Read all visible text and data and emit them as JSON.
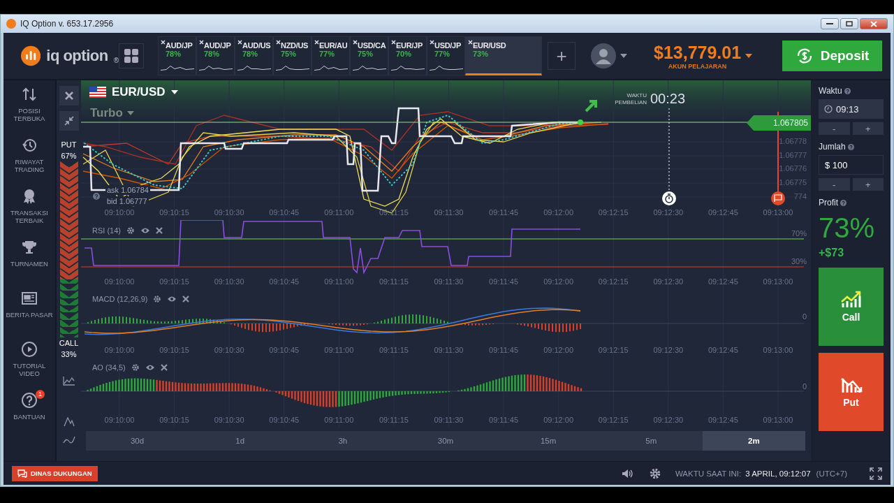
{
  "window": {
    "title": "IQ Option v. 653.17.2956"
  },
  "header": {
    "logo": "iq option",
    "logo_mark": "®",
    "asset_tabs": [
      {
        "pair": "AUD/JP",
        "payout": "78%",
        "selected": false
      },
      {
        "pair": "AUD/JP",
        "payout": "78%",
        "selected": false
      },
      {
        "pair": "AUD/US",
        "payout": "78%",
        "selected": false
      },
      {
        "pair": "NZD/US",
        "payout": "75%",
        "selected": false
      },
      {
        "pair": "EUR/AU",
        "payout": "77%",
        "selected": false
      },
      {
        "pair": "USD/CA",
        "payout": "75%",
        "selected": false
      },
      {
        "pair": "EUR/JP",
        "payout": "70%",
        "selected": false
      },
      {
        "pair": "USD/JP",
        "payout": "77%",
        "selected": false
      },
      {
        "pair": "EUR/USD",
        "payout": "73%",
        "selected": true
      }
    ],
    "balance": "$13,779.01",
    "account": "AKUN PELAJARAN",
    "deposit": "Deposit"
  },
  "sidebar": {
    "items": [
      {
        "label": "POSISI TERBUKA"
      },
      {
        "label": "RIWAYAT TRADING"
      },
      {
        "label": "TRANSAKSI TERBAIK"
      },
      {
        "label": "TURNAMEN"
      },
      {
        "label": "BERITA PASAR"
      },
      {
        "label": "TUTORIAL VIDEO"
      },
      {
        "label": "BANTUAN",
        "badge": "1"
      }
    ]
  },
  "chart": {
    "asset": "EUR/USD",
    "mode": "Turbo",
    "sentiment": {
      "put_label": "PUT",
      "put_share": "67%",
      "call_label": "CALL",
      "call_share": "33%",
      "level": 0.67
    },
    "purchase_label": "WAKTU PEMBELIAN",
    "countdown": "00:23",
    "current_price": "1.067805",
    "price_ticks": [
      "1.06778",
      "1.06777",
      "1.06776",
      "1.06775",
      "774"
    ],
    "ask": "ask 1.06784",
    "bid": "bid 1.06777",
    "time_ticks": [
      "09:10:00",
      "09:10:15",
      "09:10:30",
      "09:10:45",
      "09:11:00",
      "09:11:15",
      "09:11:30",
      "09:11:45",
      "09:12:00",
      "09:12:15",
      "09:12:30",
      "09:12:45",
      "09:13:00"
    ],
    "indicators": [
      {
        "name": "RSI (14)",
        "kind": "rsi",
        "levels": [
          "70%",
          "30%"
        ],
        "time_ticks": [
          "09:10:00",
          "09:10:15",
          "09:10:30",
          "09:10:45",
          "09:11:00",
          "09:11:15",
          "09:11:30",
          "09:11:45",
          "09:12:00",
          "09:12:15",
          "09:12:30",
          "09:12:45",
          "09:13:00"
        ]
      },
      {
        "name": "MACD (12,26,9)",
        "kind": "macd",
        "levels": [
          "0"
        ],
        "time_ticks": [
          "09:10:00",
          "09:10:15",
          "09:10:30",
          "09:10:45",
          "09:11:00",
          "09:11:15",
          "09:11:30",
          "09:11:45",
          "09:12:00",
          "09:12:15",
          "09:12:30",
          "09:12:45",
          "09:13:00"
        ]
      },
      {
        "name": "AO (34,5)",
        "kind": "ao",
        "levels": [
          "0"
        ],
        "time_ticks": [
          "09:10:00",
          "09:10:15",
          "09:10:30",
          "09:10:45",
          "09:11:00",
          "09:11:15",
          "09:11:30",
          "09:11:45",
          "09:12:00",
          "09:12:15",
          "09:12:30",
          "09:12:45",
          "09:13:00"
        ]
      }
    ],
    "timeframes": [
      {
        "label": "30d",
        "selected": false
      },
      {
        "label": "1d",
        "selected": false
      },
      {
        "label": "3h",
        "selected": false
      },
      {
        "label": "30m",
        "selected": false
      },
      {
        "label": "15m",
        "selected": false
      },
      {
        "label": "5m",
        "selected": false
      },
      {
        "label": "2m",
        "selected": true
      }
    ]
  },
  "trade_panel": {
    "time_label": "Waktu",
    "time_value": "09:13",
    "minus": "-",
    "plus": "+",
    "amount_label": "Jumlah",
    "amount_value": "$ 100",
    "profit_label": "Profit",
    "profit_percent": "73%",
    "profit_amount": "+$73",
    "call": "Call",
    "put": "Put"
  },
  "status_bar": {
    "support": "DINAS DUKUNGAN",
    "clock_label": "WAKTU SAAT INI:",
    "clock_value": "3 APRIL, 09:12:07",
    "timezone": "(UTC+7)"
  }
}
